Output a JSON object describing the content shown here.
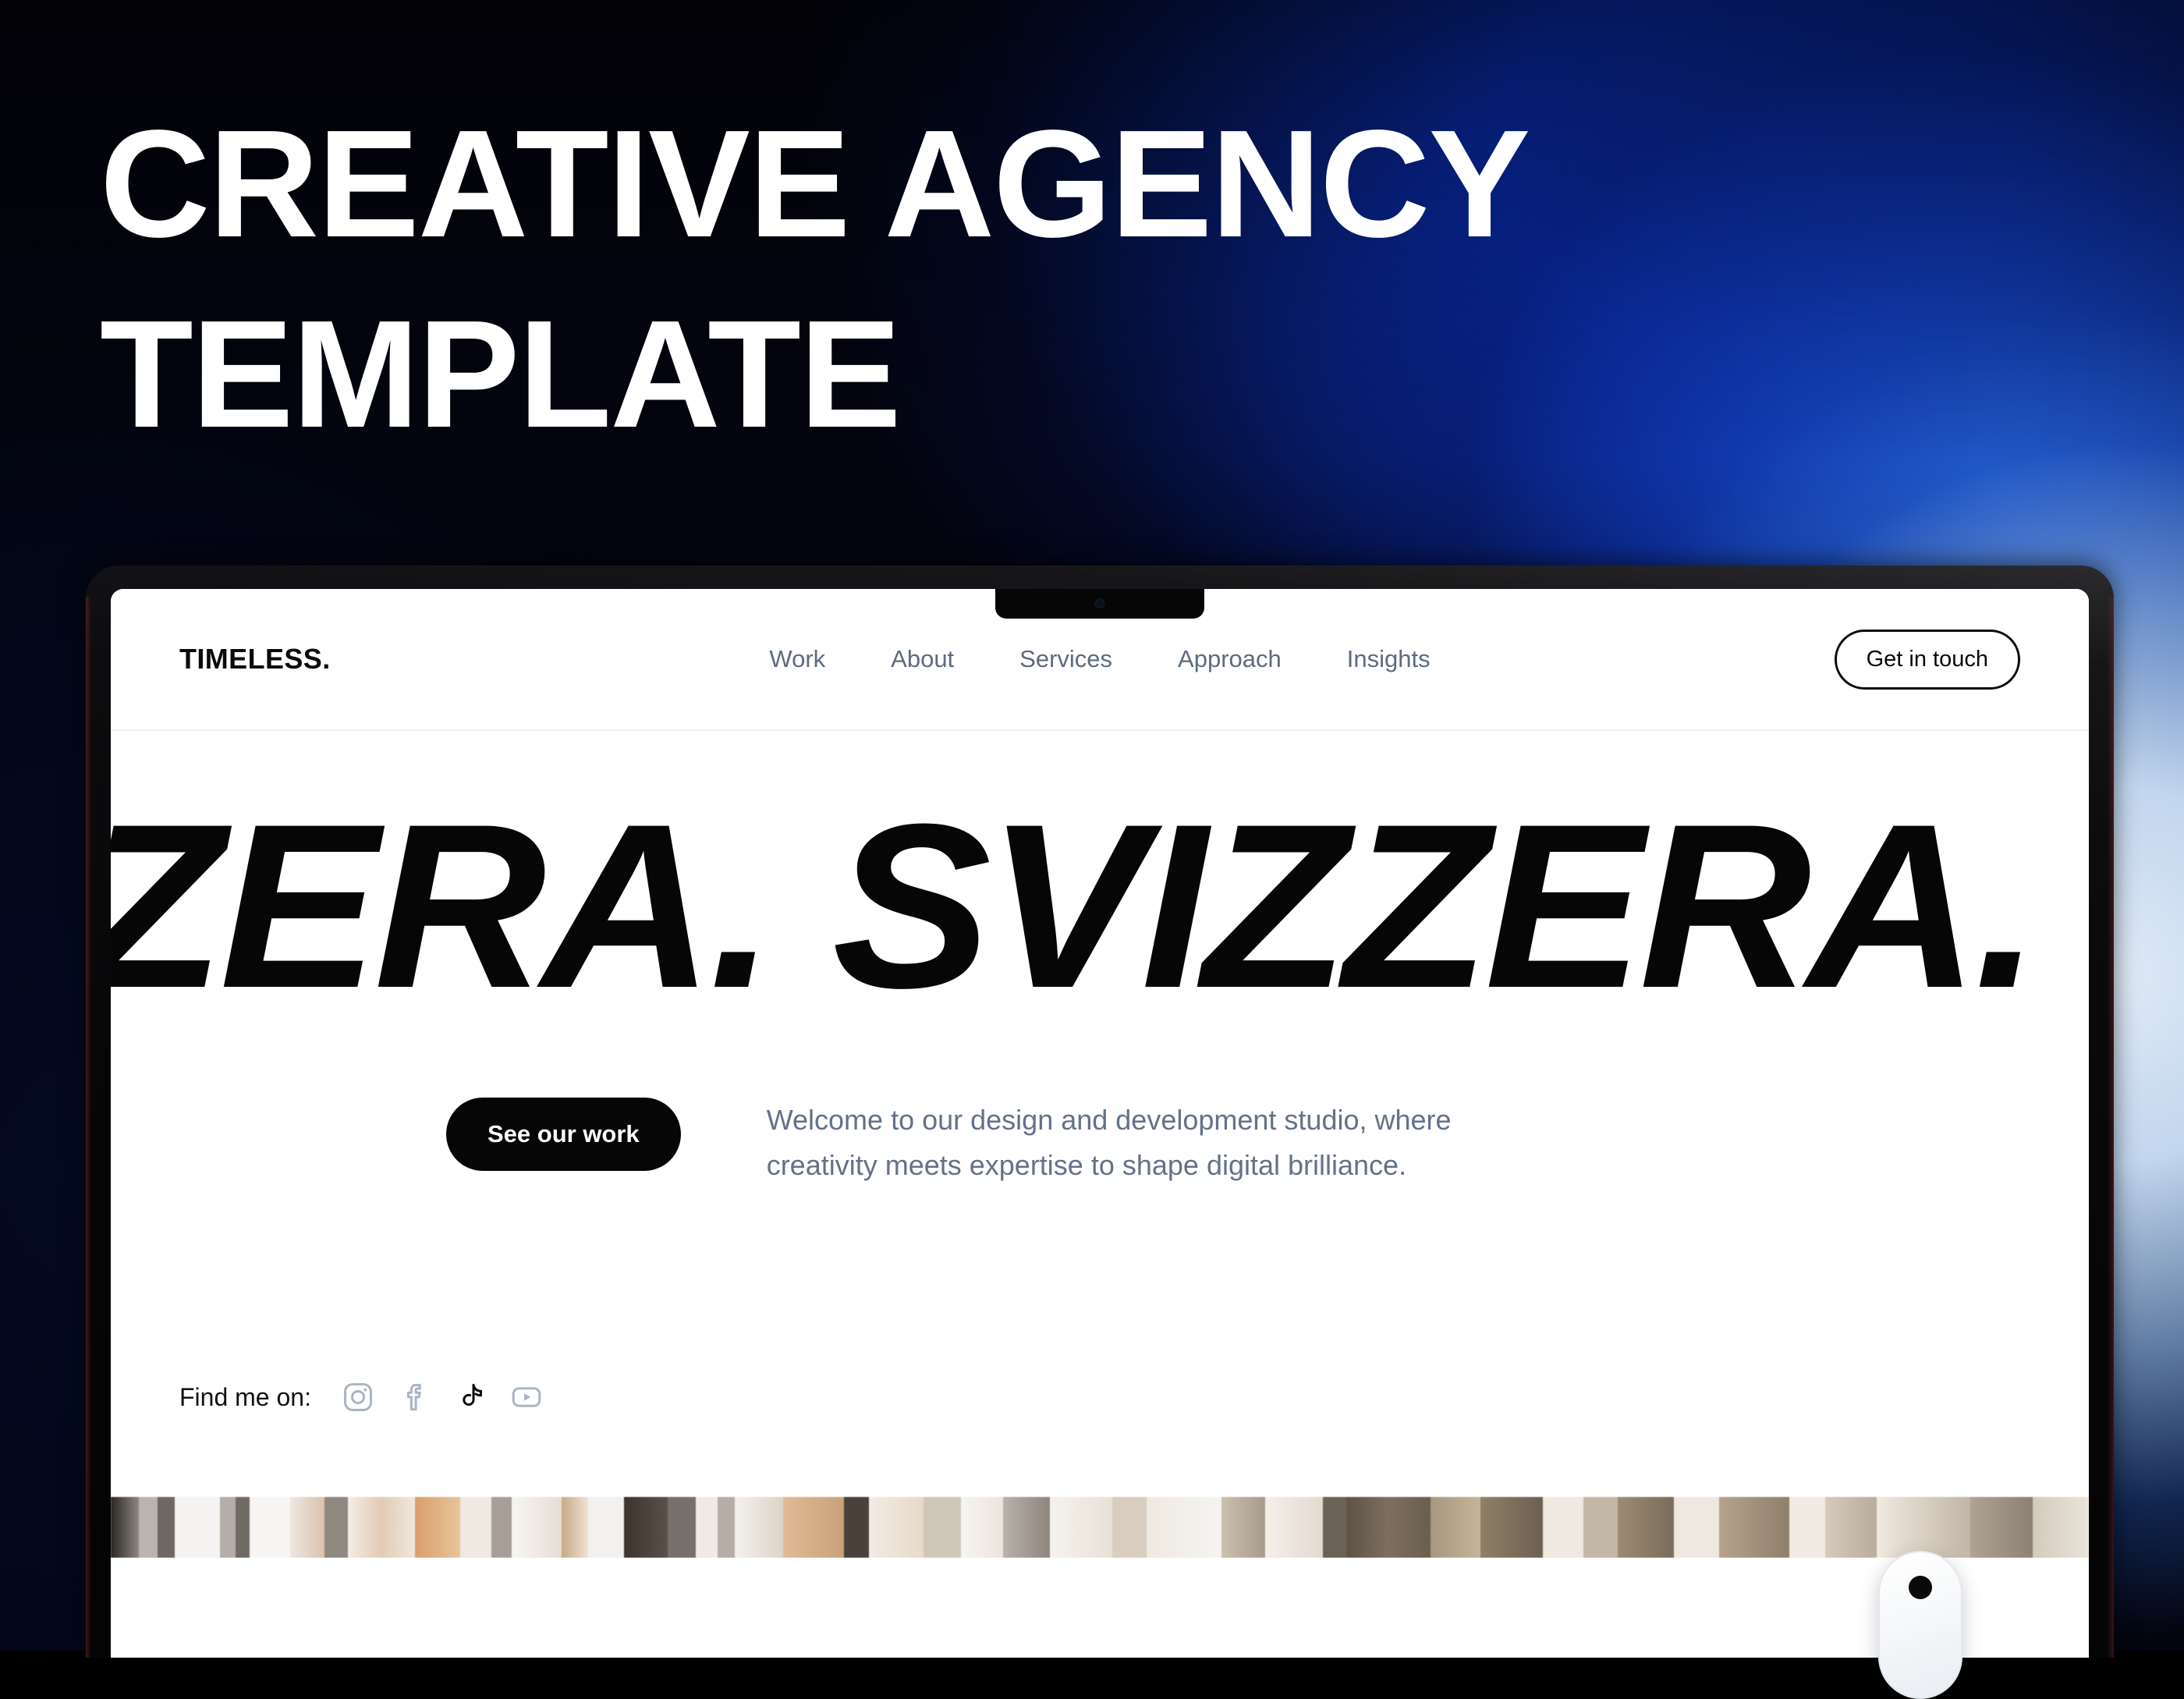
{
  "poster": {
    "headline_line1": "CREATIVE AGENCY",
    "headline_line2": "TEMPLATE",
    "bg_colors": {
      "black": "#000000",
      "deep_navy": "#03071a",
      "brand_blue": "#0b37d6",
      "mid_blue": "#1444cf",
      "pale_blue": "#cfe0f2",
      "near_white": "#eef4fb"
    }
  },
  "device": {
    "type": "laptop",
    "bezel_color": "#0c0c0e",
    "notch": "camera-notch"
  },
  "site": {
    "header": {
      "logo": "TIMELESS.",
      "nav": [
        {
          "label": "Work"
        },
        {
          "label": "About"
        },
        {
          "label": "Services"
        },
        {
          "label": "Approach"
        },
        {
          "label": "Insights"
        }
      ],
      "cta_label": "Get in touch",
      "nav_link_color": "#5d6a82"
    },
    "hero": {
      "marquee_text": "IZZERA. SVIZZERA. SVIZZERA.",
      "primary_button": "See our work",
      "paragraph": "Welcome to our design and development studio, where creativity meets expertise to shape digital brilliance.",
      "paragraph_color": "#64718a"
    },
    "social": {
      "label": "Find me on:",
      "items": [
        {
          "name": "instagram",
          "icon": "instagram-icon",
          "color": "#a9b4c6"
        },
        {
          "name": "facebook",
          "icon": "facebook-icon",
          "color": "#a9b4c6"
        },
        {
          "name": "tiktok",
          "icon": "tiktok-icon",
          "color": "#0a0a0a"
        },
        {
          "name": "youtube",
          "icon": "youtube-icon",
          "color": "#a9b4c6"
        }
      ]
    }
  },
  "peripherals": {
    "mouse": "magic-mouse"
  }
}
